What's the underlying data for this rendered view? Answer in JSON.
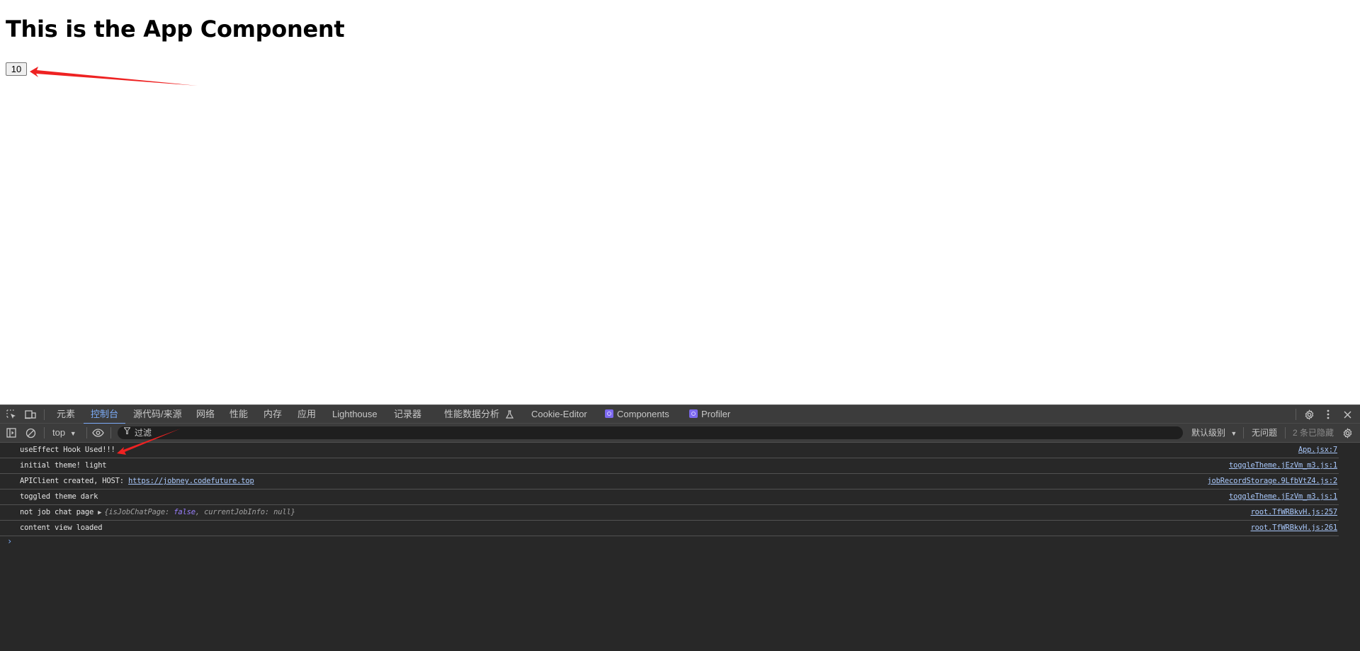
{
  "page": {
    "heading": "This is the App Component",
    "counter_button_label": "10",
    "annotation_color": "#ee2222"
  },
  "devtools": {
    "tabs": [
      {
        "label": "元素",
        "active": false
      },
      {
        "label": "控制台",
        "active": true
      },
      {
        "label": "源代码/来源",
        "active": false
      },
      {
        "label": "网络",
        "active": false
      },
      {
        "label": "性能",
        "active": false
      },
      {
        "label": "内存",
        "active": false
      },
      {
        "label": "应用",
        "active": false
      },
      {
        "label": "Lighthouse",
        "active": false
      },
      {
        "label": "记录器",
        "active": false
      },
      {
        "label": "性能数据分析",
        "active": false,
        "icon": "flask-icon"
      },
      {
        "label": "Cookie-Editor",
        "active": false
      },
      {
        "label": "Components",
        "active": false,
        "icon": "react-icon"
      },
      {
        "label": "Profiler",
        "active": false,
        "icon": "react-icon"
      }
    ],
    "toolbar": {
      "context": "top",
      "filter_placeholder": "过滤",
      "log_level": "默认级别",
      "issues": "无问题",
      "hidden_count": "2 条已隐藏"
    },
    "accent_color": "#7cacf8",
    "link_color": "#a8c7fa",
    "messages": [
      {
        "text": "useEffect Hook Used!!!",
        "source": "App.jsx:7"
      },
      {
        "text": "initial theme! light",
        "source": "toggleTheme.jEzVm_m3.js:1"
      },
      {
        "text": "APIClient created, HOST: ",
        "link": "https://jobney.codefuture.top",
        "source": "jobRecordStorage.9LfbVtZ4.js:2"
      },
      {
        "text": "toggled theme dark",
        "source": "toggleTheme.jEzVm_m3.js:1"
      },
      {
        "text": "not job chat page",
        "object": {
          "open": "{",
          "key1": "isJobChatPage",
          "val1": "false",
          "sep": ", ",
          "key2": "currentJobInfo",
          "val2": "null",
          "close": "}"
        },
        "source": "root.TfWRBkvH.js:257"
      },
      {
        "text": "content view loaded",
        "source": "root.TfWRBkvH.js:261"
      }
    ],
    "prompt_symbol": "›"
  }
}
